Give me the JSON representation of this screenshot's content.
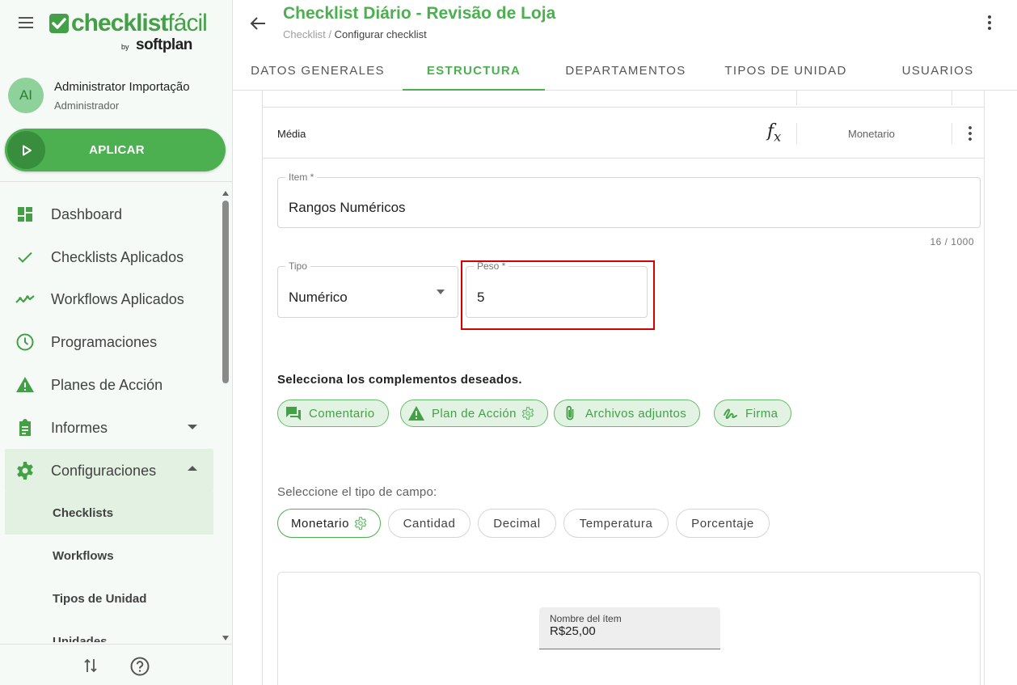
{
  "sidebar": {
    "logo": {
      "brand_bold": "checklist",
      "brand_thin": "fácil",
      "by": "by",
      "company": "softplan"
    },
    "user": {
      "initials": "AI",
      "name": "Administrator Importação",
      "role": "Administrador"
    },
    "apply_label": "APLICAR",
    "nav": [
      {
        "label": "Dashboard",
        "icon": "dashboard-icon"
      },
      {
        "label": "Checklists Aplicados",
        "icon": "check-icon"
      },
      {
        "label": "Workflows Aplicados",
        "icon": "trending-icon"
      },
      {
        "label": "Programaciones",
        "icon": "clock-icon"
      },
      {
        "label": "Planes de Acción",
        "icon": "warning-icon"
      },
      {
        "label": "Informes",
        "icon": "clipboard-icon"
      },
      {
        "label": "Configuraciones",
        "icon": "gear-icon"
      }
    ],
    "sub_nav": [
      {
        "label": "Checklists"
      },
      {
        "label": "Workflows"
      },
      {
        "label": "Tipos de Unidad"
      },
      {
        "label": "Unidades"
      }
    ]
  },
  "header": {
    "title": "Checklist Diário - Revisão de Loja",
    "breadcrumb_parent": "Checklist",
    "breadcrumb_sep": " / ",
    "breadcrumb_current": "Configurar checklist",
    "tabs": [
      {
        "label": "DATOS GENERALES"
      },
      {
        "label": "ESTRUCTURA"
      },
      {
        "label": "DEPARTAMENTOS"
      },
      {
        "label": "TIPOS DE UNIDAD"
      },
      {
        "label": "USUARIOS"
      }
    ]
  },
  "main": {
    "media_row": {
      "label": "Média",
      "formula_symbol": "f",
      "formula_sub": "x",
      "value": "Monetario"
    },
    "item_field": {
      "label": "Item *",
      "value": "Rangos Numéricos",
      "counter": "16 / 1000"
    },
    "tipo_field": {
      "label": "Tipo",
      "value": "Numérico"
    },
    "peso_field": {
      "label": "Peso *",
      "value": "5"
    },
    "complements_title": "Selecciona los complementos deseados.",
    "complements": [
      {
        "label": "Comentario",
        "icon": "comment-icon"
      },
      {
        "label": "Plan de Acción",
        "icon": "warning-icon"
      },
      {
        "label": "Archivos adjuntos",
        "icon": "paperclip-icon"
      },
      {
        "label": "Firma",
        "icon": "signature-icon"
      }
    ],
    "field_type_title": "Seleccione el tipo de campo:",
    "field_types": [
      {
        "label": "Monetario",
        "selected": true
      },
      {
        "label": "Cantidad"
      },
      {
        "label": "Decimal"
      },
      {
        "label": "Temperatura"
      },
      {
        "label": "Porcentaje"
      }
    ],
    "preview": {
      "label": "Nombre del ítem",
      "value": "R$25,00"
    }
  },
  "colors": {
    "brand": "#4caf50",
    "brand_dark": "#388e3c",
    "highlight": "#d50000",
    "chip_bg": "#e3f3e3"
  }
}
